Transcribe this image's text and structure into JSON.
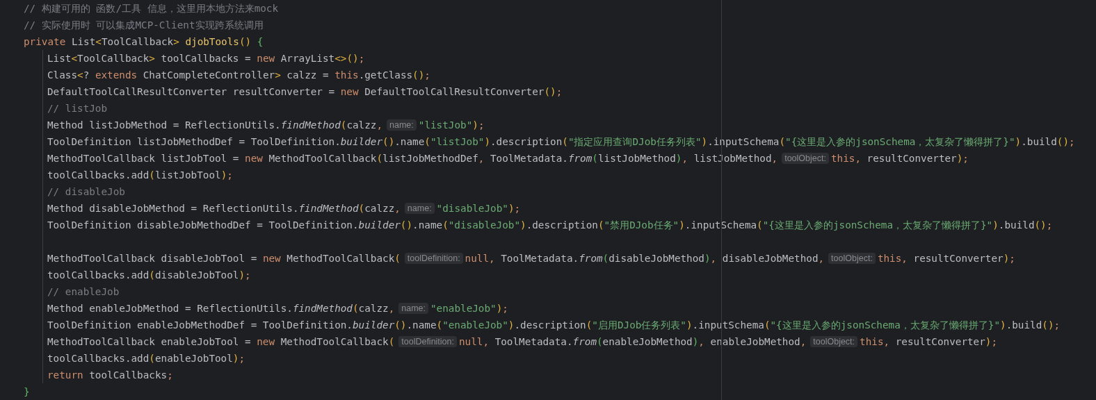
{
  "editor": {
    "comments": [
      {
        "kind": "code",
        "tokens": [
          {
            "text": "// 构建可用的 函数/工具 信息，这里用本地方法来mock",
            "kind": "comment"
          }
        ]
      },
      {
        "kind": "code",
        "tokens": [
          {
            "text": "// 实际使用时 可以集成MCP-Client实现跨系统调用",
            "kind": "comment"
          }
        ]
      }
    ],
    "signature": {
      "kind": "code",
      "tokens": [
        {
          "text": "private ",
          "kind": "keyword"
        },
        {
          "text": "List",
          "kind": "plain"
        },
        {
          "text": "<",
          "kind": "bracket"
        },
        {
          "text": "ToolCallback",
          "kind": "plain"
        },
        {
          "text": "> ",
          "kind": "bracket"
        },
        {
          "text": "djobTools",
          "kind": "declaration"
        },
        {
          "text": "() ",
          "kind": "bracket"
        },
        {
          "text": "{",
          "kind": "nested"
        }
      ]
    },
    "body": [
      {
        "kind": "code",
        "tokens": [
          {
            "text": "List",
            "kind": "plain"
          },
          {
            "text": "<",
            "kind": "bracket"
          },
          {
            "text": "ToolCallback",
            "kind": "plain"
          },
          {
            "text": ">",
            "kind": "bracket"
          },
          {
            "text": " toolCallbacks = ",
            "kind": "plain"
          },
          {
            "text": "new",
            "kind": "keyword"
          },
          {
            "text": " ArrayList",
            "kind": "plain"
          },
          {
            "text": "<>()",
            "kind": "bracket"
          },
          {
            "text": ";",
            "kind": "keyword"
          }
        ]
      },
      {
        "kind": "code",
        "tokens": [
          {
            "text": "Class",
            "kind": "plain"
          },
          {
            "text": "<",
            "kind": "bracket"
          },
          {
            "text": "? ",
            "kind": "plain"
          },
          {
            "text": "extends",
            "kind": "keyword"
          },
          {
            "text": " ChatCompleteController",
            "kind": "plain"
          },
          {
            "text": ">",
            "kind": "bracket"
          },
          {
            "text": " calzz = ",
            "kind": "plain"
          },
          {
            "text": "this",
            "kind": "keyword"
          },
          {
            "text": ".getClass",
            "kind": "plain"
          },
          {
            "text": "()",
            "kind": "bracket"
          },
          {
            "text": ";",
            "kind": "keyword"
          }
        ]
      },
      {
        "kind": "code",
        "tokens": [
          {
            "text": "DefaultToolCallResultConverter resultConverter = ",
            "kind": "plain"
          },
          {
            "text": "new",
            "kind": "keyword"
          },
          {
            "text": " DefaultToolCallResultConverter",
            "kind": "plain"
          },
          {
            "text": "()",
            "kind": "bracket"
          },
          {
            "text": ";",
            "kind": "keyword"
          }
        ]
      },
      {
        "kind": "code",
        "tokens": [
          {
            "text": "// listJob",
            "kind": "comment"
          }
        ]
      },
      {
        "kind": "code",
        "tokens": [
          {
            "text": "Method listJobMethod = ReflectionUtils.",
            "kind": "plain"
          },
          {
            "text": "findMethod",
            "kind": "italic"
          },
          {
            "text": "(",
            "kind": "bracket"
          },
          {
            "text": "calzz",
            "kind": "plain"
          },
          {
            "text": ",",
            "kind": "keyword"
          },
          {
            "text": "name:",
            "kind": "hint"
          },
          {
            "text": "\"listJob\"",
            "kind": "string"
          },
          {
            "text": ")",
            "kind": "bracket"
          },
          {
            "text": ";",
            "kind": "keyword"
          }
        ]
      },
      {
        "kind": "code",
        "tokens": [
          {
            "text": "ToolDefinition listJobMethodDef = ToolDefinition.",
            "kind": "plain"
          },
          {
            "text": "builder",
            "kind": "italic"
          },
          {
            "text": "()",
            "kind": "bracket"
          },
          {
            "text": ".name",
            "kind": "plain"
          },
          {
            "text": "(",
            "kind": "bracket"
          },
          {
            "text": "\"listJob\"",
            "kind": "string"
          },
          {
            "text": ")",
            "kind": "bracket"
          },
          {
            "text": ".description",
            "kind": "plain"
          },
          {
            "text": "(",
            "kind": "bracket"
          },
          {
            "text": "\"指定应用查询DJob任务列表\"",
            "kind": "string"
          },
          {
            "text": ")",
            "kind": "bracket"
          },
          {
            "text": ".inputSchema",
            "kind": "plain"
          },
          {
            "text": "(",
            "kind": "bracket"
          },
          {
            "text": "\"{这里是入参的jsonSchema，太复杂了懒得拼了}\"",
            "kind": "string"
          },
          {
            "text": ")",
            "kind": "bracket"
          },
          {
            "text": ".build",
            "kind": "plain"
          },
          {
            "text": "()",
            "kind": "bracket"
          },
          {
            "text": ";",
            "kind": "keyword"
          }
        ]
      },
      {
        "kind": "code",
        "tokens": [
          {
            "text": "MethodToolCallback listJobTool = ",
            "kind": "plain"
          },
          {
            "text": "new",
            "kind": "keyword"
          },
          {
            "text": " MethodToolCallback",
            "kind": "plain"
          },
          {
            "text": "(",
            "kind": "bracket"
          },
          {
            "text": "listJobMethodDef",
            "kind": "plain"
          },
          {
            "text": ",",
            "kind": "keyword"
          },
          {
            "text": " ToolMetadata.",
            "kind": "plain"
          },
          {
            "text": "from",
            "kind": "italic"
          },
          {
            "text": "(",
            "kind": "nested"
          },
          {
            "text": "listJobMethod",
            "kind": "plain"
          },
          {
            "text": ")",
            "kind": "nested"
          },
          {
            "text": ",",
            "kind": "keyword"
          },
          {
            "text": " listJobMethod",
            "kind": "plain"
          },
          {
            "text": ",",
            "kind": "keyword"
          },
          {
            "text": "toolObject:",
            "kind": "hint"
          },
          {
            "text": "this",
            "kind": "keyword"
          },
          {
            "text": ",",
            "kind": "keyword"
          },
          {
            "text": " resultConverter",
            "kind": "plain"
          },
          {
            "text": ")",
            "kind": "bracket"
          },
          {
            "text": ";",
            "kind": "keyword"
          }
        ]
      },
      {
        "kind": "code",
        "tokens": [
          {
            "text": "toolCallbacks.add",
            "kind": "plain"
          },
          {
            "text": "(",
            "kind": "bracket"
          },
          {
            "text": "listJobTool",
            "kind": "plain"
          },
          {
            "text": ")",
            "kind": "bracket"
          },
          {
            "text": ";",
            "kind": "keyword"
          }
        ]
      },
      {
        "kind": "code",
        "tokens": [
          {
            "text": "// disableJob",
            "kind": "comment"
          }
        ]
      },
      {
        "kind": "code",
        "tokens": [
          {
            "text": "Method disableJobMethod = ReflectionUtils.",
            "kind": "plain"
          },
          {
            "text": "findMethod",
            "kind": "italic"
          },
          {
            "text": "(",
            "kind": "bracket"
          },
          {
            "text": "calzz",
            "kind": "plain"
          },
          {
            "text": ",",
            "kind": "keyword"
          },
          {
            "text": "name:",
            "kind": "hint"
          },
          {
            "text": "\"disableJob\"",
            "kind": "string"
          },
          {
            "text": ")",
            "kind": "bracket"
          },
          {
            "text": ";",
            "kind": "keyword"
          }
        ]
      },
      {
        "kind": "code",
        "tokens": [
          {
            "text": "ToolDefinition disableJobMethodDef = ToolDefinition.",
            "kind": "plain"
          },
          {
            "text": "builder",
            "kind": "italic"
          },
          {
            "text": "()",
            "kind": "bracket"
          },
          {
            "text": ".name",
            "kind": "plain"
          },
          {
            "text": "(",
            "kind": "bracket"
          },
          {
            "text": "\"disableJob\"",
            "kind": "string"
          },
          {
            "text": ")",
            "kind": "bracket"
          },
          {
            "text": ".description",
            "kind": "plain"
          },
          {
            "text": "(",
            "kind": "bracket"
          },
          {
            "text": "\"禁用DJob任务\"",
            "kind": "string"
          },
          {
            "text": ")",
            "kind": "bracket"
          },
          {
            "text": ".inputSchema",
            "kind": "plain"
          },
          {
            "text": "(",
            "kind": "bracket"
          },
          {
            "text": "\"{这里是入参的jsonSchema，太复杂了懒得拼了}\"",
            "kind": "string"
          },
          {
            "text": ")",
            "kind": "bracket"
          },
          {
            "text": ".build",
            "kind": "plain"
          },
          {
            "text": "()",
            "kind": "bracket"
          },
          {
            "text": ";",
            "kind": "keyword"
          }
        ]
      },
      {
        "kind": "blank"
      },
      {
        "kind": "code",
        "tokens": [
          {
            "text": "MethodToolCallback disableJobTool = ",
            "kind": "plain"
          },
          {
            "text": "new",
            "kind": "keyword"
          },
          {
            "text": " MethodToolCallback",
            "kind": "plain"
          },
          {
            "text": "(",
            "kind": "bracket"
          },
          {
            "text": "toolDefinition:",
            "kind": "hint"
          },
          {
            "text": "null",
            "kind": "keyword"
          },
          {
            "text": ",",
            "kind": "keyword"
          },
          {
            "text": " ToolMetadata.",
            "kind": "plain"
          },
          {
            "text": "from",
            "kind": "italic"
          },
          {
            "text": "(",
            "kind": "nested"
          },
          {
            "text": "disableJobMethod",
            "kind": "plain"
          },
          {
            "text": ")",
            "kind": "nested"
          },
          {
            "text": ",",
            "kind": "keyword"
          },
          {
            "text": " disableJobMethod",
            "kind": "plain"
          },
          {
            "text": ",",
            "kind": "keyword"
          },
          {
            "text": "toolObject:",
            "kind": "hint"
          },
          {
            "text": "this",
            "kind": "keyword"
          },
          {
            "text": ",",
            "kind": "keyword"
          },
          {
            "text": " resultConverter",
            "kind": "plain"
          },
          {
            "text": ")",
            "kind": "bracket"
          },
          {
            "text": ";",
            "kind": "keyword"
          }
        ]
      },
      {
        "kind": "code",
        "tokens": [
          {
            "text": "toolCallbacks.add",
            "kind": "plain"
          },
          {
            "text": "(",
            "kind": "bracket"
          },
          {
            "text": "disableJobTool",
            "kind": "plain"
          },
          {
            "text": ")",
            "kind": "bracket"
          },
          {
            "text": ";",
            "kind": "keyword"
          }
        ]
      },
      {
        "kind": "code",
        "tokens": [
          {
            "text": "// enableJob",
            "kind": "comment"
          }
        ]
      },
      {
        "kind": "code",
        "tokens": [
          {
            "text": "Method enableJobMethod = ReflectionUtils.",
            "kind": "plain"
          },
          {
            "text": "findMethod",
            "kind": "italic"
          },
          {
            "text": "(",
            "kind": "bracket"
          },
          {
            "text": "calzz",
            "kind": "plain"
          },
          {
            "text": ",",
            "kind": "keyword"
          },
          {
            "text": "name:",
            "kind": "hint"
          },
          {
            "text": "\"enableJob\"",
            "kind": "string"
          },
          {
            "text": ")",
            "kind": "bracket"
          },
          {
            "text": ";",
            "kind": "keyword"
          }
        ]
      },
      {
        "kind": "code",
        "tokens": [
          {
            "text": "ToolDefinition enableJobMethodDef = ToolDefinition.",
            "kind": "plain"
          },
          {
            "text": "builder",
            "kind": "italic"
          },
          {
            "text": "()",
            "kind": "bracket"
          },
          {
            "text": ".name",
            "kind": "plain"
          },
          {
            "text": "(",
            "kind": "bracket"
          },
          {
            "text": "\"enableJob\"",
            "kind": "string"
          },
          {
            "text": ")",
            "kind": "bracket"
          },
          {
            "text": ".description",
            "kind": "plain"
          },
          {
            "text": "(",
            "kind": "bracket"
          },
          {
            "text": "\"启用DJob任务列表\"",
            "kind": "string"
          },
          {
            "text": ")",
            "kind": "bracket"
          },
          {
            "text": ".inputSchema",
            "kind": "plain"
          },
          {
            "text": "(",
            "kind": "bracket"
          },
          {
            "text": "\"{这里是入参的jsonSchema，太复杂了懒得拼了}\"",
            "kind": "string"
          },
          {
            "text": ")",
            "kind": "bracket"
          },
          {
            "text": ".build",
            "kind": "plain"
          },
          {
            "text": "()",
            "kind": "bracket"
          },
          {
            "text": ";",
            "kind": "keyword"
          }
        ]
      },
      {
        "kind": "code",
        "tokens": [
          {
            "text": "MethodToolCallback enableJobTool = ",
            "kind": "plain"
          },
          {
            "text": "new",
            "kind": "keyword"
          },
          {
            "text": " MethodToolCallback",
            "kind": "plain"
          },
          {
            "text": "(",
            "kind": "bracket"
          },
          {
            "text": "toolDefinition:",
            "kind": "hint"
          },
          {
            "text": "null",
            "kind": "keyword"
          },
          {
            "text": ",",
            "kind": "keyword"
          },
          {
            "text": " ToolMetadata.",
            "kind": "plain"
          },
          {
            "text": "from",
            "kind": "italic"
          },
          {
            "text": "(",
            "kind": "nested"
          },
          {
            "text": "enableJobMethod",
            "kind": "plain"
          },
          {
            "text": ")",
            "kind": "nested"
          },
          {
            "text": ",",
            "kind": "keyword"
          },
          {
            "text": " enableJobMethod",
            "kind": "plain"
          },
          {
            "text": ",",
            "kind": "keyword"
          },
          {
            "text": "toolObject:",
            "kind": "hint"
          },
          {
            "text": "this",
            "kind": "keyword"
          },
          {
            "text": ",",
            "kind": "keyword"
          },
          {
            "text": " resultConverter",
            "kind": "plain"
          },
          {
            "text": ")",
            "kind": "bracket"
          },
          {
            "text": ";",
            "kind": "keyword"
          }
        ]
      },
      {
        "kind": "code",
        "tokens": [
          {
            "text": "toolCallbacks.add",
            "kind": "plain"
          },
          {
            "text": "(",
            "kind": "bracket"
          },
          {
            "text": "enableJobTool",
            "kind": "plain"
          },
          {
            "text": ")",
            "kind": "bracket"
          },
          {
            "text": ";",
            "kind": "keyword"
          }
        ]
      },
      {
        "kind": "code",
        "tokens": [
          {
            "text": "return",
            "kind": "keyword"
          },
          {
            "text": " toolCallbacks",
            "kind": "plain"
          },
          {
            "text": ";",
            "kind": "keyword"
          }
        ]
      }
    ],
    "closing": {
      "kind": "code",
      "tokens": [
        {
          "text": "}",
          "kind": "nested"
        }
      ]
    }
  }
}
